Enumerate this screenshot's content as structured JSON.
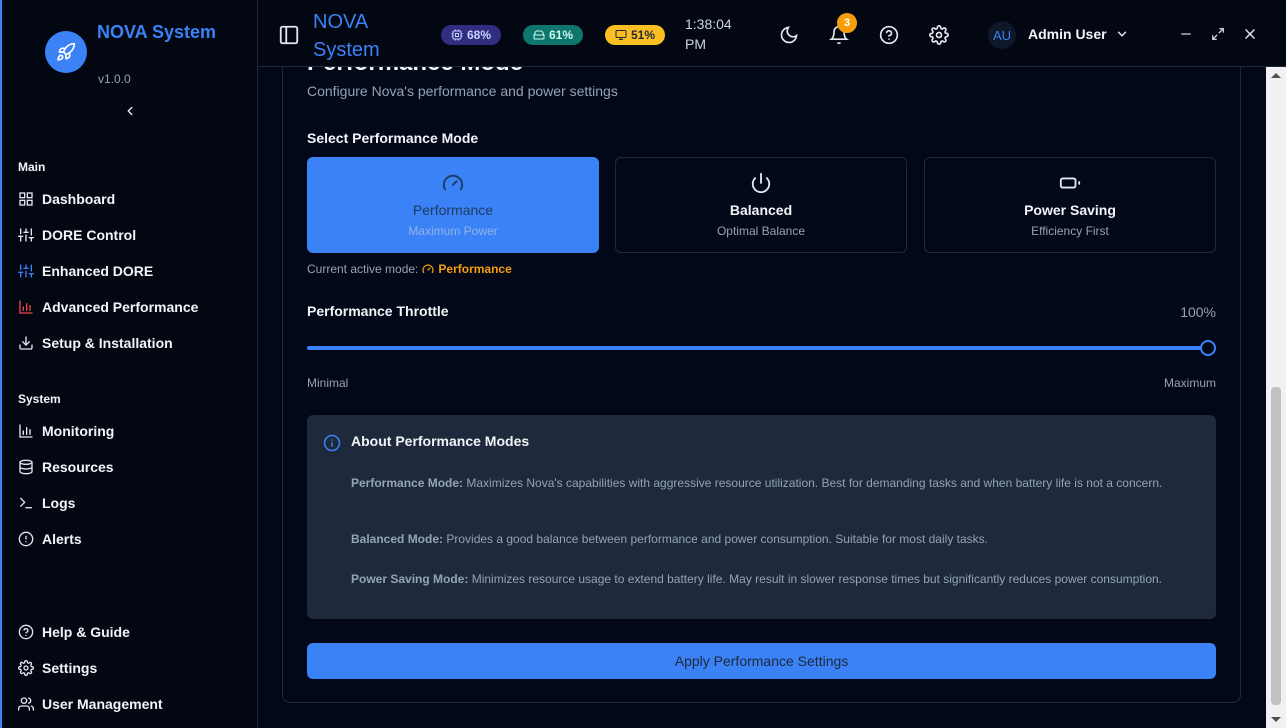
{
  "app": {
    "name": "NOVA System",
    "version": "v1.0.0"
  },
  "sidebar": {
    "sections": [
      {
        "label": "Main",
        "items": [
          {
            "label": "Dashboard",
            "icon": "grid-icon"
          },
          {
            "label": "DORE Control",
            "icon": "sliders-icon"
          },
          {
            "label": "Enhanced DORE",
            "icon": "sliders-blue-icon"
          },
          {
            "label": "Advanced Performance",
            "icon": "bar-chart-red-icon"
          },
          {
            "label": "Setup & Installation",
            "icon": "download-icon"
          }
        ]
      },
      {
        "label": "System",
        "items": [
          {
            "label": "Monitoring",
            "icon": "bar-chart-icon"
          },
          {
            "label": "Resources",
            "icon": "database-icon"
          },
          {
            "label": "Logs",
            "icon": "terminal-icon"
          },
          {
            "label": "Alerts",
            "icon": "alert-circle-icon"
          }
        ]
      }
    ],
    "footer": [
      {
        "label": "Help & Guide",
        "icon": "help-circle-icon"
      },
      {
        "label": "Settings",
        "icon": "gear-icon"
      },
      {
        "label": "User Management",
        "icon": "users-icon"
      }
    ]
  },
  "header": {
    "title": "NOVA System",
    "stats": [
      {
        "label": "68%",
        "icon": "cpu-icon",
        "color": "#312e81",
        "text": "#c7d2fe"
      },
      {
        "label": "61%",
        "icon": "hard-drive-icon",
        "color": "#0f766e",
        "text": "#ccfbf1"
      },
      {
        "label": "51%",
        "icon": "monitor-icon",
        "color": "#fbbf24",
        "text": "#1f2937"
      }
    ],
    "time": "1:38:04 PM",
    "notifications": "3",
    "user": {
      "initials": "AU",
      "name": "Admin User"
    }
  },
  "content": {
    "title": "Performance Mode",
    "subtitle": "Configure Nova's performance and power settings",
    "select_label": "Select Performance Mode",
    "modes": [
      {
        "name": "Performance",
        "desc": "Maximum Power",
        "icon": "gauge-icon",
        "active": true
      },
      {
        "name": "Balanced",
        "desc": "Optimal Balance",
        "icon": "power-icon",
        "active": false
      },
      {
        "name": "Power Saving",
        "desc": "Efficiency First",
        "icon": "battery-icon",
        "active": false
      }
    ],
    "current_label": "Current active mode:",
    "current_mode": "Performance",
    "throttle": {
      "label": "Performance Throttle",
      "value_text": "100%",
      "value": 100,
      "min_label": "Minimal",
      "max_label": "Maximum"
    },
    "about": {
      "title": "About Performance Modes",
      "items": [
        {
          "term": "Performance Mode:",
          "text": " Maximizes Nova's capabilities with aggressive resource utilization. Best for demanding tasks and when battery life is not a concern."
        },
        {
          "term": "Balanced Mode:",
          "text": " Provides a good balance between performance and power consumption. Suitable for most daily tasks."
        },
        {
          "term": "Power Saving Mode:",
          "text": " Minimizes resource usage to extend battery life. May result in slower response times but significantly reduces power consumption."
        }
      ]
    },
    "apply_label": "Apply Performance Settings"
  },
  "colors": {
    "accent": "#3b82f6",
    "warning": "#f59e0b",
    "background": "#020817"
  }
}
